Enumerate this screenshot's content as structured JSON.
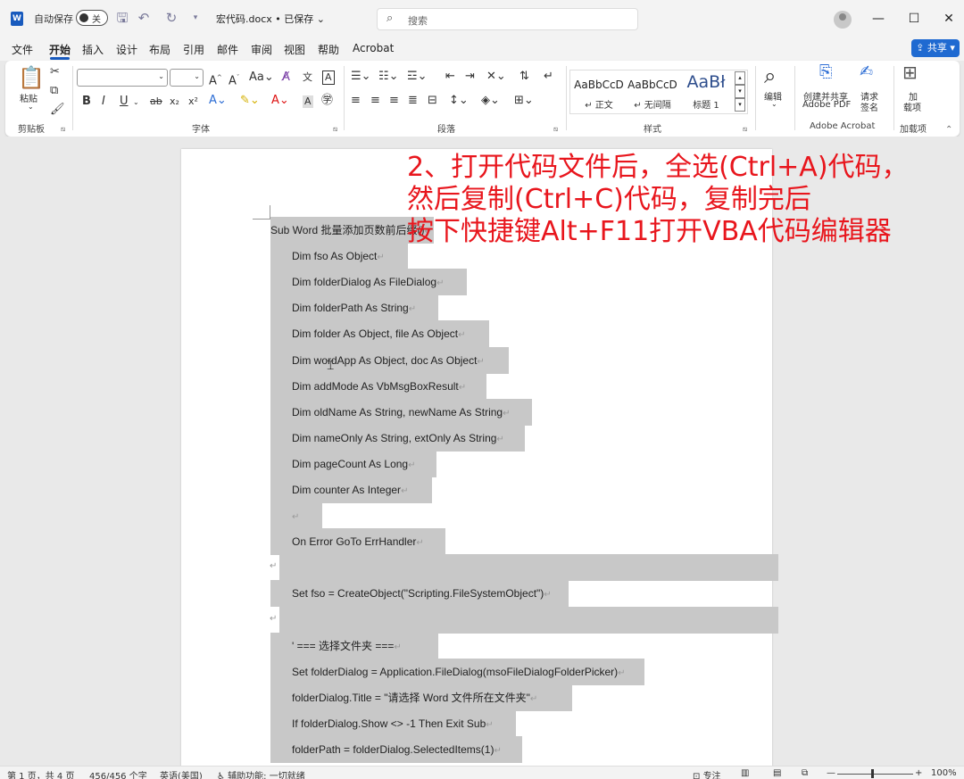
{
  "titlebar": {
    "app_logo": "W",
    "autosave_label": "自动保存",
    "autosave_state": "关",
    "doc_title": "宏代码.docx • 已保存",
    "search_placeholder": "搜索",
    "icons": [
      "save-icon",
      "undo-icon",
      "redo-icon",
      "customize-icon"
    ]
  },
  "menu": {
    "items": [
      "文件",
      "开始",
      "插入",
      "设计",
      "布局",
      "引用",
      "邮件",
      "审阅",
      "视图",
      "帮助",
      "Acrobat"
    ],
    "active": "开始",
    "share_label": "共享"
  },
  "ribbon": {
    "clipboard": {
      "paste_label": "粘贴",
      "group_label": "剪贴板"
    },
    "font": {
      "group_label": "字体"
    },
    "paragraph": {
      "group_label": "段落"
    },
    "styles": {
      "group_label": "样式",
      "items": [
        {
          "sample": "AaBbCcD",
          "name": "正文"
        },
        {
          "sample": "AaBbCcD",
          "name": "无间隔"
        },
        {
          "sample": "AaBł",
          "name": "标题 1"
        }
      ]
    },
    "editing": {
      "label": "编辑"
    },
    "acrobat": {
      "create_label_1": "创建并共享",
      "create_label_2": "Adobe PDF",
      "sign_label_1": "请求",
      "sign_label_2": "签名",
      "group_label": "Adobe Acrobat"
    },
    "addins": {
      "label_1": "加",
      "label_2": "载项",
      "group_label": "加载项"
    }
  },
  "overlay": {
    "lines": [
      "2、打开代码文件后，全选(Ctrl+A)代码，",
      "然后复制(Ctrl+C)代码，复制完后",
      "按下快捷键Alt+F11打开VBA代码编辑器"
    ],
    "color": "#e8161d"
  },
  "document": {
    "lines": [
      {
        "text": "Sub Word 批量添加页数前后缀()",
        "indent": false
      },
      {
        "text": "Dim fso As Object",
        "indent": true
      },
      {
        "text": "Dim folderDialog As FileDialog",
        "indent": true
      },
      {
        "text": "Dim folderPath As String",
        "indent": true
      },
      {
        "text": "Dim folder As Object, file As Object",
        "indent": true
      },
      {
        "text": "Dim wordApp As Object, doc As Object",
        "indent": true
      },
      {
        "text": "Dim addMode As VbMsgBoxResult",
        "indent": true
      },
      {
        "text": "Dim oldName As String, newName As String",
        "indent": true
      },
      {
        "text": "Dim nameOnly As String, extOnly As String",
        "indent": true
      },
      {
        "text": "Dim pageCount As Long",
        "indent": true
      },
      {
        "text": "Dim counter As Integer",
        "indent": true
      },
      {
        "text": "",
        "indent": true
      },
      {
        "text": "On Error GoTo ErrHandler",
        "indent": true
      },
      {
        "text": "",
        "indent": false
      },
      {
        "text": "Set fso = CreateObject(\"Scripting.FileSystemObject\")",
        "indent": true
      },
      {
        "text": "",
        "indent": false
      },
      {
        "text": "' ===  选择文件夹  ===",
        "indent": true
      },
      {
        "text": "Set folderDialog = Application.FileDialog(msoFileDialogFolderPicker)",
        "indent": true
      },
      {
        "text": "folderDialog.Title = \"请选择  Word  文件所在文件夹\"",
        "indent": true
      },
      {
        "text": "If folderDialog.Show <> -1 Then Exit Sub",
        "indent": true
      },
      {
        "text": "folderPath = folderDialog.SelectedItems(1)",
        "indent": true
      }
    ],
    "paragraph_mark": "↵",
    "selection_color": "#c8c8c8"
  },
  "statusbar": {
    "page": "第 1 页，共 4 页",
    "words": "456/456 个字",
    "language": "英语(美国)",
    "accessibility": "辅助功能: 一切就绪",
    "focus": "专注",
    "zoom": "100%"
  }
}
